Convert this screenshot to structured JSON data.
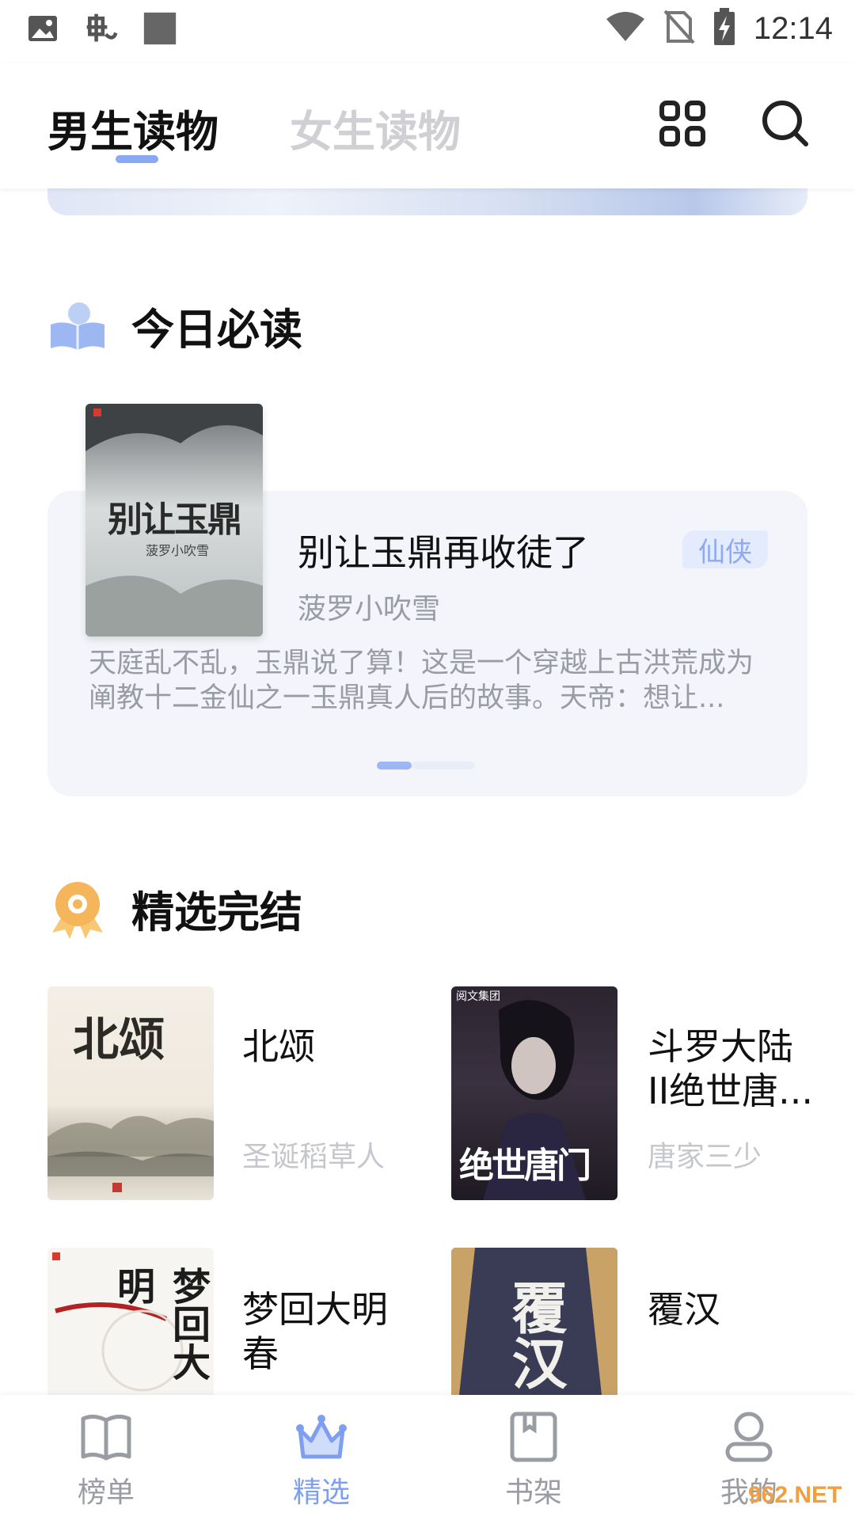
{
  "status_bar": {
    "time": "12:14"
  },
  "header": {
    "tabs": [
      {
        "label": "男生读物",
        "active": true
      },
      {
        "label": "女生读物",
        "active": false
      }
    ]
  },
  "today_section": {
    "title": "今日必读",
    "book": {
      "title": "别让玉鼎再收徒了",
      "author": "菠罗小吹雪",
      "genre": "仙侠",
      "description": "天庭乱不乱，玉鼎说了算！这是一个穿越上古洪荒成为阐教十二金仙之一玉鼎真人后的故事。天帝：想让...",
      "cover_text": "别让玉鼎"
    }
  },
  "finished_section": {
    "title": "精选完结",
    "books": [
      {
        "title": "北颂",
        "author": "圣诞稻草人",
        "cover_text": "北颂"
      },
      {
        "title": "斗罗大陆II绝世唐...",
        "author": "唐家三少",
        "cover_text": "绝世唐门",
        "cover_badge": "阅文集团"
      },
      {
        "title": "梦回大明春",
        "author": "",
        "cover_text": "梦回大明"
      },
      {
        "title": "覆汉",
        "author": "",
        "cover_text": "覆汉"
      }
    ]
  },
  "bottom_nav": {
    "items": [
      {
        "label": "榜单",
        "active": false
      },
      {
        "label": "精选",
        "active": true
      },
      {
        "label": "书架",
        "active": false
      },
      {
        "label": "我的",
        "active": false
      }
    ]
  },
  "watermark": "962.NET",
  "colors": {
    "accent": "#8aa8f5",
    "card_bg": "#f3f5fa",
    "muted_text": "#9a9ca3"
  }
}
